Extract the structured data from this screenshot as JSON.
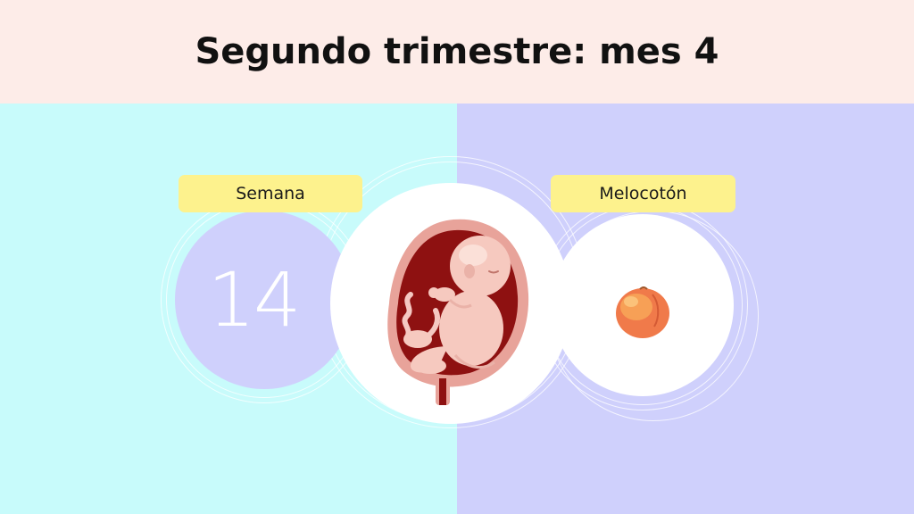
{
  "header": {
    "title": "Segundo trimestre: mes 4"
  },
  "week": {
    "label": "Semana",
    "number": "14"
  },
  "fruit": {
    "label": "Melocotón",
    "icon": "peach-icon"
  },
  "illustration": {
    "icon": "fetus-in-uterus-icon"
  },
  "colors": {
    "header_bg": "#fdece8",
    "left_panel_bg": "#c8fbfb",
    "right_panel_bg": "#cfd0fc",
    "label_bg": "#fdf28d"
  }
}
